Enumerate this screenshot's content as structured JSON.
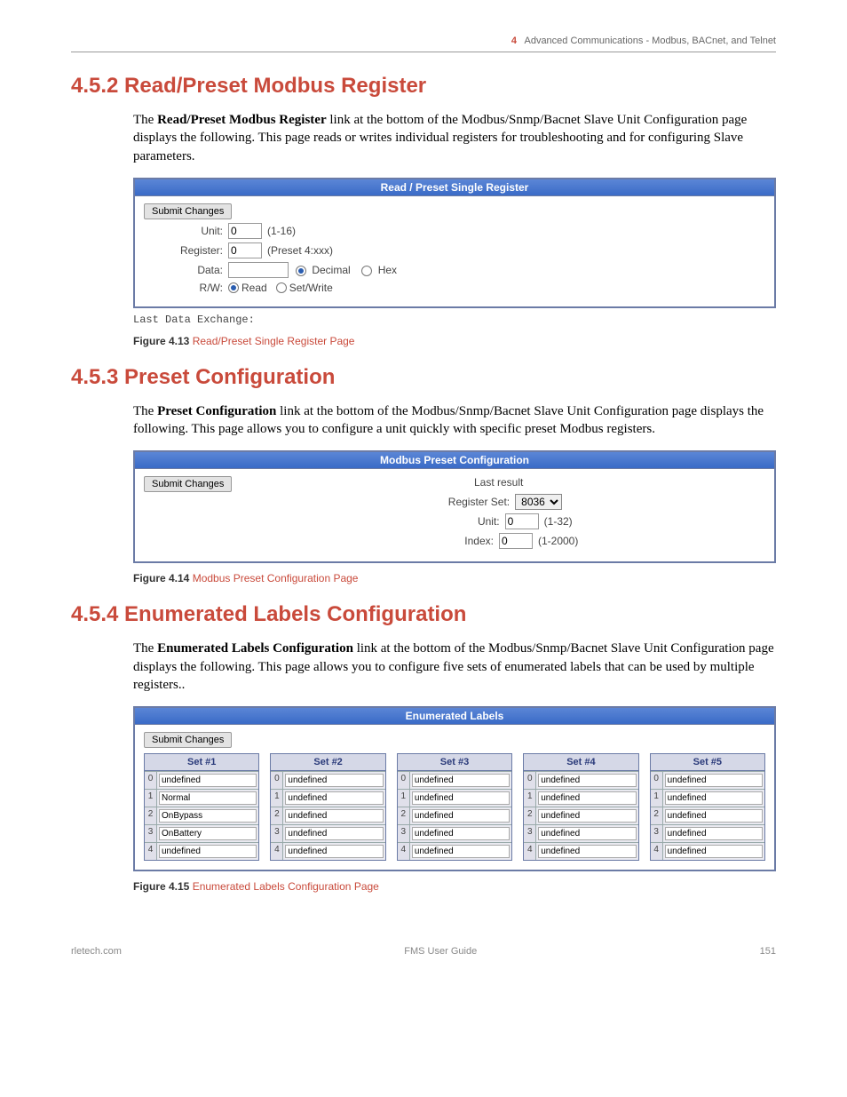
{
  "header": {
    "chapter_number": "4",
    "chapter_title": "Advanced Communications - Modbus, BACnet, and Telnet"
  },
  "sec1": {
    "heading": "4.5.2 Read/Preset Modbus Register",
    "para_a": "The ",
    "para_bold": "Read/Preset Modbus Register",
    "para_b": " link at the bottom of the Modbus/Snmp/Bacnet Slave Unit Configuration page displays the following. This page reads or writes individual registers for troubleshooting and for configuring Slave parameters.",
    "panel_title": "Read / Preset Single Register",
    "submit": "Submit Changes",
    "unit_label": "Unit:",
    "unit_value": "0",
    "unit_hint": "(1-16)",
    "register_label": "Register:",
    "register_value": "0",
    "register_hint": "(Preset 4:xxx)",
    "data_label": "Data:",
    "decimal": "Decimal",
    "hex": "Hex",
    "rw_label": "R/W:",
    "read": "Read",
    "setwrite": "Set/Write",
    "last": "Last Data Exchange:",
    "fig_num": "Figure 4.13",
    "fig_title": "Read/Preset Single Register Page"
  },
  "sec2": {
    "heading": "4.5.3 Preset Configuration",
    "para_a": "The ",
    "para_bold": "Preset Configuration",
    "para_b": " link at the bottom of the Modbus/Snmp/Bacnet Slave Unit Configuration page displays the following. This page allows you to configure a unit quickly with specific preset Modbus registers.",
    "panel_title": "Modbus Preset Configuration",
    "submit": "Submit Changes",
    "last_result": "Last result",
    "reg_set_label": "Register Set:",
    "reg_set_value": "8036",
    "unit_label": "Unit:",
    "unit_value": "0",
    "unit_hint": "(1-32)",
    "index_label": "Index:",
    "index_value": "0",
    "index_hint": "(1-2000)",
    "fig_num": "Figure 4.14",
    "fig_title": "Modbus Preset Configuration Page"
  },
  "sec3": {
    "heading": "4.5.4 Enumerated Labels Configuration",
    "para_a": "The ",
    "para_bold": "Enumerated Labels Configuration",
    "para_b": " link at the bottom of the Modbus/Snmp/Bacnet Slave Unit Configuration page displays the following. This page allows you to configure five sets of enumerated labels that can be used by multiple registers..",
    "panel_title": "Enumerated Labels",
    "submit": "Submit Changes",
    "sets": [
      {
        "name": "Set #1",
        "rows": [
          "undefined",
          "Normal",
          "OnBypass",
          "OnBattery",
          "undefined"
        ]
      },
      {
        "name": "Set #2",
        "rows": [
          "undefined",
          "undefined",
          "undefined",
          "undefined",
          "undefined"
        ]
      },
      {
        "name": "Set #3",
        "rows": [
          "undefined",
          "undefined",
          "undefined",
          "undefined",
          "undefined"
        ]
      },
      {
        "name": "Set #4",
        "rows": [
          "undefined",
          "undefined",
          "undefined",
          "undefined",
          "undefined"
        ]
      },
      {
        "name": "Set #5",
        "rows": [
          "undefined",
          "undefined",
          "undefined",
          "undefined",
          "undefined"
        ]
      }
    ],
    "fig_num": "Figure 4.15",
    "fig_title": "Enumerated Labels Configuration Page"
  },
  "footer": {
    "left": "rletech.com",
    "center": "FMS User Guide",
    "right": "151"
  }
}
